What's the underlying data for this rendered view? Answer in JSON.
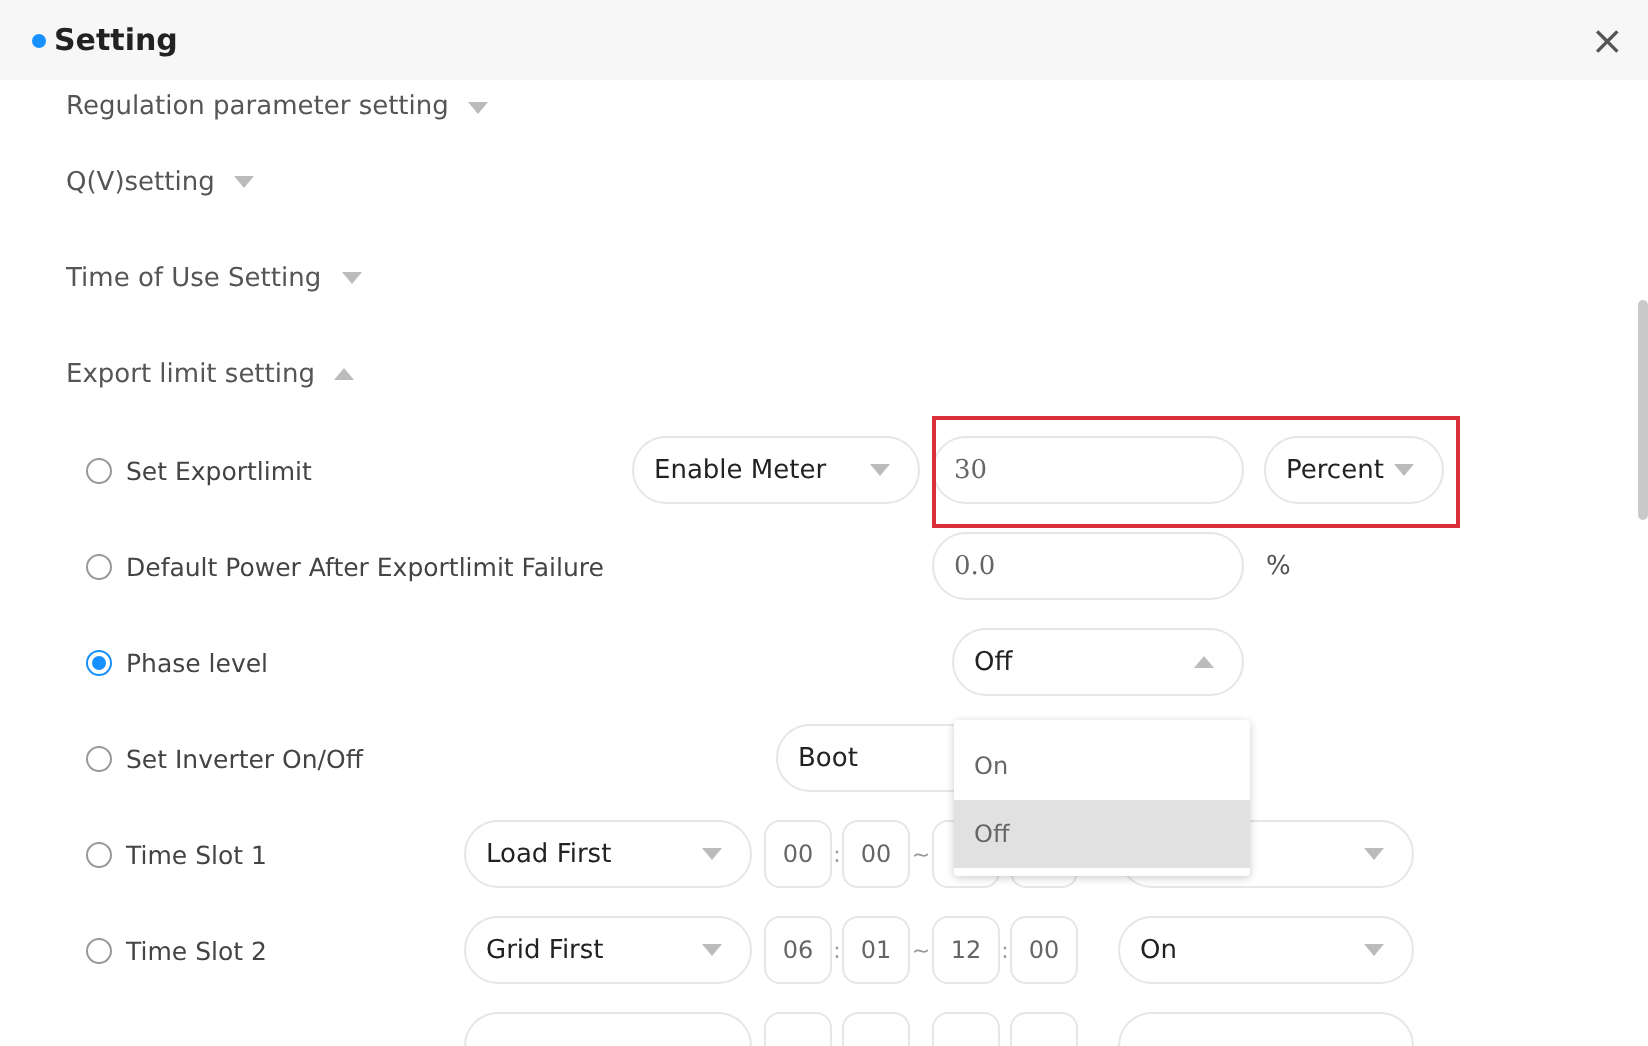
{
  "window": {
    "title": "Setting",
    "close": "×"
  },
  "sections": [
    {
      "label": "Regulation parameter setting",
      "expanded": false
    },
    {
      "label": "Q(V)setting",
      "expanded": false
    },
    {
      "label": "Time of Use Setting",
      "expanded": false
    },
    {
      "label": "Export limit setting",
      "expanded": true
    }
  ],
  "rows": [
    {
      "kind": "export",
      "label": "Set Exportlimit",
      "selected": false,
      "mode": "Enable Meter",
      "value": "30",
      "unit": "Percent"
    },
    {
      "kind": "default",
      "label": "Default Power After Exportlimit Failure",
      "selected": false,
      "value": "0.0",
      "unit": "%"
    },
    {
      "kind": "phase",
      "label": "Phase level",
      "selected": true,
      "value": "Off",
      "open": true,
      "options": [
        {
          "label": "On",
          "selected": false
        },
        {
          "label": "Off",
          "selected": true
        }
      ]
    },
    {
      "kind": "inverter",
      "label": "Set Inverter On/Off",
      "selected": false,
      "value": "Boot"
    },
    {
      "kind": "slot",
      "label": "Time Slot 1",
      "selected": false,
      "mode": "Load First",
      "start": [
        "00",
        "00"
      ],
      "separators": [
        ":",
        "~"
      ]
    },
    {
      "kind": "slot",
      "label": "Time Slot 2",
      "selected": false,
      "mode": "Grid First",
      "start": [
        "06",
        "01"
      ],
      "end": [
        "12",
        "00"
      ],
      "separators": [
        ":",
        "~",
        ":"
      ],
      "state": "On"
    },
    {
      "kind": "slot"
    }
  ]
}
